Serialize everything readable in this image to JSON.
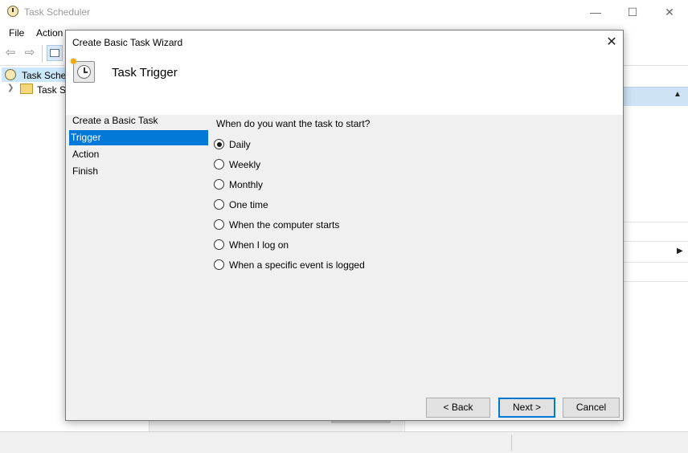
{
  "main_window": {
    "title": "Task Scheduler",
    "menu": {
      "file": "File",
      "action": "Action"
    },
    "tree": {
      "item1_label": "Task Sched",
      "item2_label": "Task Sc"
    }
  },
  "wizard": {
    "title": "Create Basic Task Wizard",
    "header_title": "Task Trigger",
    "nav": [
      "Create a Basic Task",
      "Trigger",
      "Action",
      "Finish"
    ],
    "question": "When do you want the task to start?",
    "options": [
      "Daily",
      "Weekly",
      "Monthly",
      "One time",
      "When the computer starts",
      "When I log on",
      "When a specific event is logged"
    ],
    "selected_option": "Daily",
    "buttons": {
      "back": "< Back",
      "next": "Next >",
      "cancel": "Cancel"
    }
  },
  "colors": {
    "selection": "#0078d7",
    "tree_selection": "#cce8ff",
    "actions_header": "#cfe3f7"
  },
  "icons": [
    "clock-icon",
    "folder-icon",
    "back-arrow-icon",
    "forward-arrow-icon",
    "view-icon",
    "close-icon",
    "wizard-clock-icon"
  ]
}
